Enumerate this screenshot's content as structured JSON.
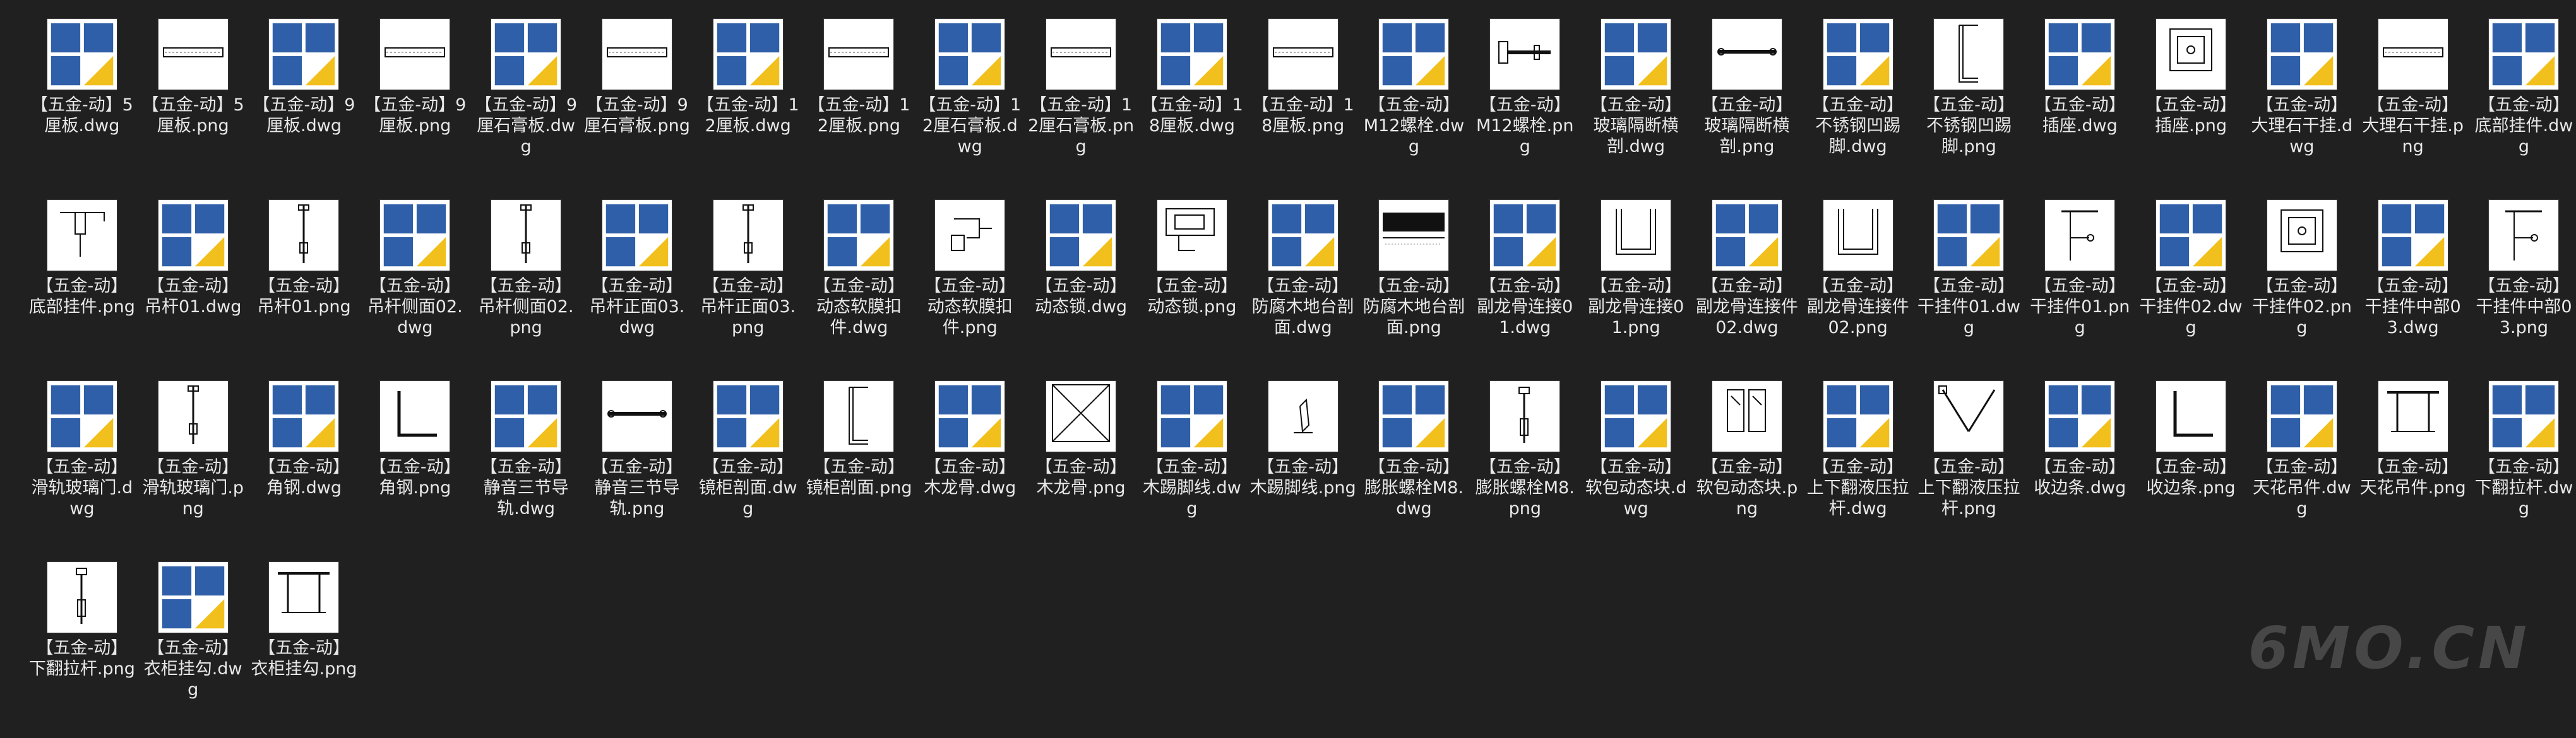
{
  "colors": {
    "background": "#202020",
    "label": "#e8e8e8",
    "badge_blue": "#2f5fa8",
    "badge_yellow": "#f2c01c"
  },
  "watermark": "6MO.CN",
  "files": [
    {
      "label": "【五金-动】5厘板.dwg",
      "ext": "dwg",
      "icon": "strip-icon"
    },
    {
      "label": "【五金-动】5厘板.png",
      "ext": "png",
      "icon": "strip-icon"
    },
    {
      "label": "【五金-动】9厘板.dwg",
      "ext": "dwg",
      "icon": "strip-icon"
    },
    {
      "label": "【五金-动】9厘板.png",
      "ext": "png",
      "icon": "strip-icon"
    },
    {
      "label": "【五金-动】9厘石膏板.dwg",
      "ext": "dwg",
      "icon": "strip-icon"
    },
    {
      "label": "【五金-动】9厘石膏板.png",
      "ext": "png",
      "icon": "strip-icon"
    },
    {
      "label": "【五金-动】12厘板.dwg",
      "ext": "dwg",
      "icon": "strip-icon"
    },
    {
      "label": "【五金-动】12厘板.png",
      "ext": "png",
      "icon": "strip-icon"
    },
    {
      "label": "【五金-动】12厘石膏板.dwg",
      "ext": "dwg",
      "icon": "strip-icon"
    },
    {
      "label": "【五金-动】12厘石膏板.png",
      "ext": "png",
      "icon": "strip-icon"
    },
    {
      "label": "【五金-动】18厘板.dwg",
      "ext": "dwg",
      "icon": "strip-icon"
    },
    {
      "label": "【五金-动】18厘板.png",
      "ext": "png",
      "icon": "strip-icon"
    },
    {
      "label": "【五金-动】M12螺栓.dwg",
      "ext": "dwg",
      "icon": "bolt-icon"
    },
    {
      "label": "【五金-动】M12螺栓.png",
      "ext": "png",
      "icon": "bolt-icon"
    },
    {
      "label": "【五金-动】玻璃隔断横剖.dwg",
      "ext": "dwg",
      "icon": "bar-icon"
    },
    {
      "label": "【五金-动】玻璃隔断横剖.png",
      "ext": "png",
      "icon": "bar-icon"
    },
    {
      "label": "【五金-动】不锈钢凹踢脚.dwg",
      "ext": "dwg",
      "icon": "profile-icon"
    },
    {
      "label": "【五金-动】不锈钢凹踢脚.png",
      "ext": "png",
      "icon": "profile-icon"
    },
    {
      "label": "【五金-动】插座.dwg",
      "ext": "dwg",
      "icon": "socket-icon"
    },
    {
      "label": "【五金-动】插座.png",
      "ext": "png",
      "icon": "socket-icon"
    },
    {
      "label": "【五金-动】大理石干挂.dwg",
      "ext": "dwg",
      "icon": "strip-icon"
    },
    {
      "label": "【五金-动】大理石干挂.png",
      "ext": "png",
      "icon": "strip-icon"
    },
    {
      "label": "【五金-动】底部挂件.dwg",
      "ext": "dwg",
      "icon": "bracket-icon"
    },
    {
      "label": "【五金-动】底部挂件.png",
      "ext": "png",
      "icon": "bracket-icon"
    },
    {
      "label": "【五金-动】吊杆01.dwg",
      "ext": "dwg",
      "icon": "rod-icon"
    },
    {
      "label": "【五金-动】吊杆01.png",
      "ext": "png",
      "icon": "rod-icon"
    },
    {
      "label": "【五金-动】吊杆侧面02.dwg",
      "ext": "dwg",
      "icon": "rod-icon"
    },
    {
      "label": "【五金-动】吊杆侧面02.png",
      "ext": "png",
      "icon": "rod-icon"
    },
    {
      "label": "【五金-动】吊杆正面03.dwg",
      "ext": "dwg",
      "icon": "rod-icon"
    },
    {
      "label": "【五金-动】吊杆正面03.png",
      "ext": "png",
      "icon": "rod-icon"
    },
    {
      "label": "【五金-动】动态软膜扣件.dwg",
      "ext": "dwg",
      "icon": "clip-icon"
    },
    {
      "label": "【五金-动】动态软膜扣件.png",
      "ext": "png",
      "icon": "clip-icon"
    },
    {
      "label": "【五金-动】动态锁.dwg",
      "ext": "dwg",
      "icon": "lock-icon"
    },
    {
      "label": "【五金-动】动态锁.png",
      "ext": "png",
      "icon": "lock-icon"
    },
    {
      "label": "【五金-动】防腐木地台剖面.dwg",
      "ext": "dwg",
      "icon": "section-icon"
    },
    {
      "label": "【五金-动】防腐木地台剖面.png",
      "ext": "png",
      "icon": "section-icon"
    },
    {
      "label": "【五金-动】副龙骨连接01.dwg",
      "ext": "dwg",
      "icon": "channel-icon"
    },
    {
      "label": "【五金-动】副龙骨连接01.png",
      "ext": "png",
      "icon": "channel-icon"
    },
    {
      "label": "【五金-动】副龙骨连接件02.dwg",
      "ext": "dwg",
      "icon": "channel-icon"
    },
    {
      "label": "【五金-动】副龙骨连接件02.png",
      "ext": "png",
      "icon": "channel-icon"
    },
    {
      "label": "【五金-动】干挂件01.dwg",
      "ext": "dwg",
      "icon": "hanger-icon"
    },
    {
      "label": "【五金-动】干挂件01.png",
      "ext": "png",
      "icon": "hanger-icon"
    },
    {
      "label": "【五金-动】干挂件02.dwg",
      "ext": "dwg",
      "icon": "socket-icon"
    },
    {
      "label": "【五金-动】干挂件02.png",
      "ext": "png",
      "icon": "socket-icon"
    },
    {
      "label": "【五金-动】干挂件中部03.dwg",
      "ext": "dwg",
      "icon": "hanger-icon"
    },
    {
      "label": "【五金-动】干挂件中部03.png",
      "ext": "png",
      "icon": "hanger-icon"
    },
    {
      "label": "【五金-动】滑轨玻璃门.dwg",
      "ext": "dwg",
      "icon": "rod-icon"
    },
    {
      "label": "【五金-动】滑轨玻璃门.png",
      "ext": "png",
      "icon": "rod-icon"
    },
    {
      "label": "【五金-动】角钢.dwg",
      "ext": "dwg",
      "icon": "angle-icon"
    },
    {
      "label": "【五金-动】角钢.png",
      "ext": "png",
      "icon": "angle-icon"
    },
    {
      "label": "【五金-动】静音三节导轨.dwg",
      "ext": "dwg",
      "icon": "bar-icon"
    },
    {
      "label": "【五金-动】静音三节导轨.png",
      "ext": "png",
      "icon": "bar-icon"
    },
    {
      "label": "【五金-动】镜柜剖面.dwg",
      "ext": "dwg",
      "icon": "profile-icon"
    },
    {
      "label": "【五金-动】镜柜剖面.png",
      "ext": "png",
      "icon": "profile-icon"
    },
    {
      "label": "【五金-动】木龙骨.dwg",
      "ext": "dwg",
      "icon": "crossbox-icon"
    },
    {
      "label": "【五金-动】木龙骨.png",
      "ext": "png",
      "icon": "crossbox-icon"
    },
    {
      "label": "【五金-动】木踢脚线.dwg",
      "ext": "dwg",
      "icon": "skirting-icon"
    },
    {
      "label": "【五金-动】木踢脚线.png",
      "ext": "png",
      "icon": "skirting-icon"
    },
    {
      "label": "【五金-动】膨胀螺栓M8.dwg",
      "ext": "dwg",
      "icon": "anchor-icon"
    },
    {
      "label": "【五金-动】膨胀螺栓M8.png",
      "ext": "png",
      "icon": "anchor-icon"
    },
    {
      "label": "【五金-动】软包动态块.dwg",
      "ext": "dwg",
      "icon": "panel-icon"
    },
    {
      "label": "【五金-动】软包动态块.png",
      "ext": "png",
      "icon": "panel-icon"
    },
    {
      "label": "【五金-动】上下翻液压拉杆.dwg",
      "ext": "dwg",
      "icon": "strut-icon"
    },
    {
      "label": "【五金-动】上下翻液压拉杆.png",
      "ext": "png",
      "icon": "strut-icon"
    },
    {
      "label": "【五金-动】收边条.dwg",
      "ext": "dwg",
      "icon": "angle-icon"
    },
    {
      "label": "【五金-动】收边条.png",
      "ext": "png",
      "icon": "angle-icon"
    },
    {
      "label": "【五金-动】天花吊件.dwg",
      "ext": "dwg",
      "icon": "ceiling-icon"
    },
    {
      "label": "【五金-动】天花吊件.png",
      "ext": "png",
      "icon": "ceiling-icon"
    },
    {
      "label": "【五金-动】下翻拉杆.dwg",
      "ext": "dwg",
      "icon": "anchor-icon"
    },
    {
      "label": "【五金-动】下翻拉杆.png",
      "ext": "png",
      "icon": "anchor-icon"
    },
    {
      "label": "【五金-动】衣柜挂勾.dwg",
      "ext": "dwg",
      "icon": "ceiling-icon"
    },
    {
      "label": "【五金-动】衣柜挂勾.png",
      "ext": "png",
      "icon": "ceiling-icon"
    }
  ]
}
